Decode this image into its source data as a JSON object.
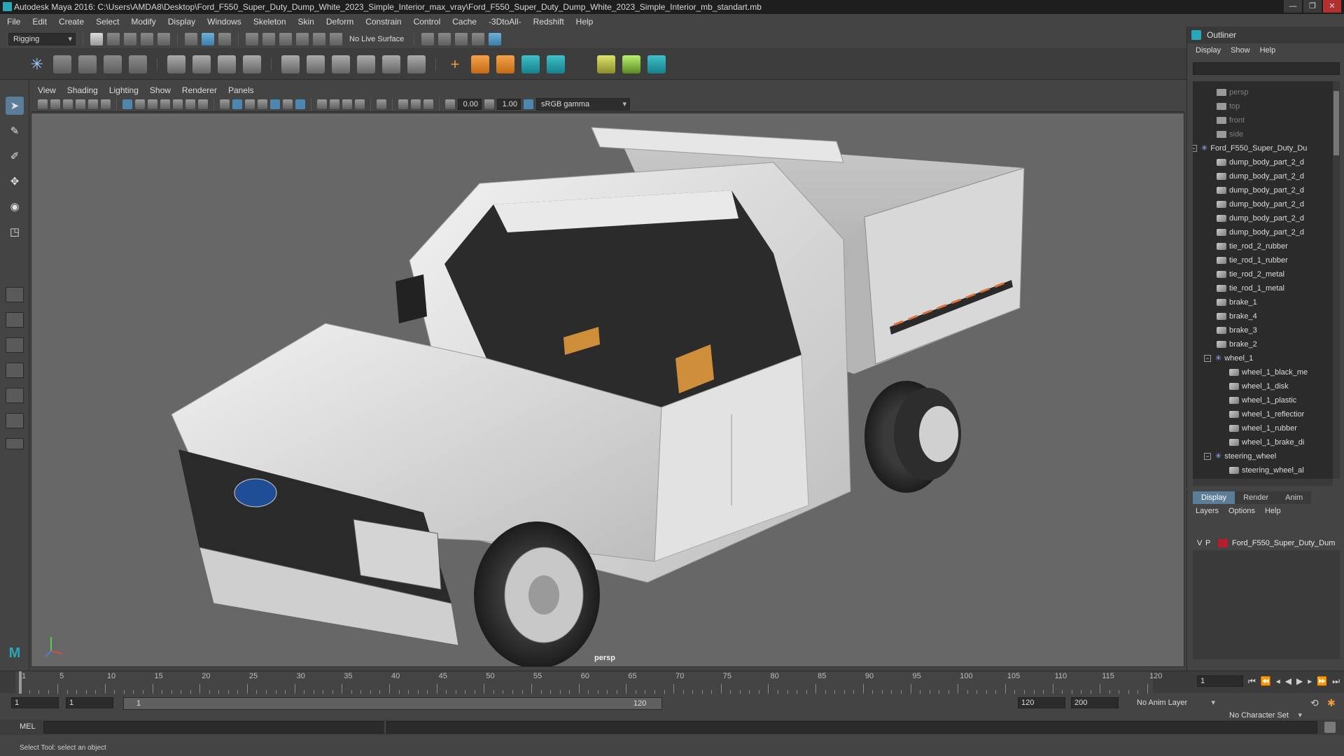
{
  "window": {
    "title": "Autodesk Maya 2016: C:\\Users\\AMDA8\\Desktop\\Ford_F550_Super_Duty_Dump_White_2023_Simple_Interior_max_vray\\Ford_F550_Super_Duty_Dump_White_2023_Simple_Interior_mb_standart.mb"
  },
  "menu": [
    "File",
    "Edit",
    "Create",
    "Select",
    "Modify",
    "Display",
    "Windows",
    "Skeleton",
    "Skin",
    "Deform",
    "Constrain",
    "Control",
    "Cache",
    "-3DtoAll-",
    "Redshift",
    "Help"
  ],
  "shelf": {
    "mode": "Rigging",
    "live_surface": "No Live Surface"
  },
  "viewport": {
    "menu": [
      "View",
      "Shading",
      "Lighting",
      "Show",
      "Renderer",
      "Panels"
    ],
    "exposure": "0.00",
    "gamma": "1.00",
    "color_space": "sRGB gamma",
    "camera_label": "persp"
  },
  "outliner": {
    "title": "Outliner",
    "menu": [
      "Display",
      "Show",
      "Help"
    ],
    "items": [
      {
        "label": "persp",
        "icon": "camera-icon",
        "level": 2,
        "dim": true
      },
      {
        "label": "top",
        "icon": "camera-icon",
        "level": 2,
        "dim": true
      },
      {
        "label": "front",
        "icon": "camera-icon",
        "level": 2,
        "dim": true
      },
      {
        "label": "side",
        "icon": "camera-icon",
        "level": 2,
        "dim": true
      },
      {
        "label": "Ford_F550_Super_Duty_Du",
        "icon": "group-icon",
        "level": 1,
        "expander": "−"
      },
      {
        "label": "dump_body_part_2_d",
        "icon": "mesh-icon",
        "level": 2
      },
      {
        "label": "dump_body_part_2_d",
        "icon": "mesh-icon",
        "level": 2
      },
      {
        "label": "dump_body_part_2_d",
        "icon": "mesh-icon",
        "level": 2
      },
      {
        "label": "dump_body_part_2_d",
        "icon": "mesh-icon",
        "level": 2
      },
      {
        "label": "dump_body_part_2_d",
        "icon": "mesh-icon",
        "level": 2
      },
      {
        "label": "dump_body_part_2_d",
        "icon": "mesh-icon",
        "level": 2
      },
      {
        "label": "tie_rod_2_rubber",
        "icon": "mesh-icon",
        "level": 2
      },
      {
        "label": "tie_rod_1_rubber",
        "icon": "mesh-icon",
        "level": 2
      },
      {
        "label": "tie_rod_2_metal",
        "icon": "mesh-icon",
        "level": 2
      },
      {
        "label": "tie_rod_1_metal",
        "icon": "mesh-icon",
        "level": 2
      },
      {
        "label": "brake_1",
        "icon": "mesh-icon",
        "level": 2
      },
      {
        "label": "brake_4",
        "icon": "mesh-icon",
        "level": 2
      },
      {
        "label": "brake_3",
        "icon": "mesh-icon",
        "level": 2
      },
      {
        "label": "brake_2",
        "icon": "mesh-icon",
        "level": 2
      },
      {
        "label": "wheel_1",
        "icon": "group-icon",
        "level": 2,
        "expander": "−"
      },
      {
        "label": "wheel_1_black_me",
        "icon": "mesh-icon",
        "level": 3
      },
      {
        "label": "wheel_1_disk",
        "icon": "mesh-icon",
        "level": 3
      },
      {
        "label": "wheel_1_plastic",
        "icon": "mesh-icon",
        "level": 3
      },
      {
        "label": "wheel_1_reflectior",
        "icon": "mesh-icon",
        "level": 3
      },
      {
        "label": "wheel_1_rubber",
        "icon": "mesh-icon",
        "level": 3
      },
      {
        "label": "wheel_1_brake_di",
        "icon": "mesh-icon",
        "level": 3
      },
      {
        "label": "steering_wheel",
        "icon": "group-icon",
        "level": 2,
        "expander": "−"
      },
      {
        "label": "steering_wheel_al",
        "icon": "mesh-icon",
        "level": 3
      }
    ]
  },
  "layers": {
    "tabs": [
      "Display",
      "Render",
      "Anim"
    ],
    "menu": [
      "Layers",
      "Options",
      "Help"
    ],
    "rows": [
      {
        "v": "V",
        "p": "P",
        "name": "Ford_F550_Super_Duty_Dum",
        "color": "#b51d2c"
      }
    ]
  },
  "timeline": {
    "ticks": [
      1,
      5,
      10,
      15,
      20,
      25,
      30,
      35,
      40,
      45,
      50,
      55,
      60,
      65,
      70,
      75,
      80,
      85,
      90,
      95,
      100,
      105,
      110,
      115,
      120
    ],
    "current_frame": "1"
  },
  "range": {
    "start": "1",
    "playback_start": "1",
    "slider_start": "1",
    "slider_end": "120",
    "playback_end": "120",
    "end": "200",
    "anim_layer": "No Anim Layer",
    "character_set": "No Character Set"
  },
  "command": {
    "label": "MEL"
  },
  "help_line": "Select Tool: select an object",
  "colors": {
    "accent": "#5b7d97",
    "maya_teal": "#29a6b8",
    "layer_red": "#b51d2c"
  }
}
